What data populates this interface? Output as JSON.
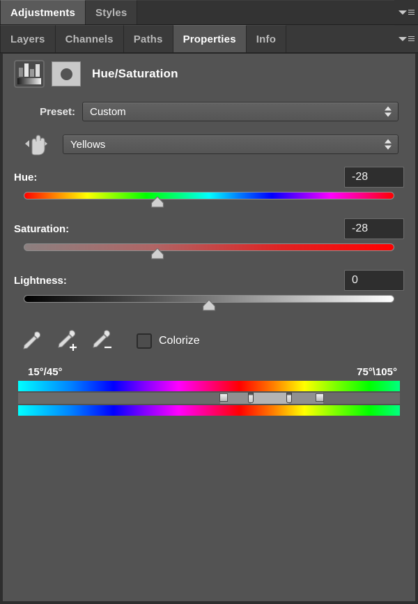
{
  "window": {
    "top_tabs": [
      {
        "label": "Adjustments",
        "active": true
      },
      {
        "label": "Styles",
        "active": false
      }
    ],
    "panel_tabs": [
      {
        "label": "Layers",
        "active": false
      },
      {
        "label": "Channels",
        "active": false
      },
      {
        "label": "Paths",
        "active": false
      },
      {
        "label": "Properties",
        "active": true
      },
      {
        "label": "Info",
        "active": false
      }
    ],
    "menu_icon": "panel-menu-icon"
  },
  "adjustment": {
    "title": "Hue/Saturation",
    "adjust_icon": "hue-saturation-adjustment-icon",
    "mask_icon": "layer-mask-thumbnail-icon"
  },
  "preset": {
    "label": "Preset:",
    "value": "Custom"
  },
  "channel": {
    "value": "Yellows",
    "tool_icon": "on-image-adjustment-hand-icon"
  },
  "sliders": [
    {
      "name": "hue",
      "label": "Hue:",
      "value": "-28",
      "thumb_percent": 36
    },
    {
      "name": "saturation",
      "label": "Saturation:",
      "value": "-28",
      "thumb_percent": 36
    },
    {
      "name": "lightness",
      "label": "Lightness:",
      "value": "0",
      "thumb_percent": 50
    }
  ],
  "tools": {
    "eyedropper": "eyedropper-icon",
    "eyedropper_add": "eyedropper-add-icon",
    "eyedropper_subtract": "eyedropper-subtract-icon",
    "colorize_label": "Colorize",
    "colorize_checked": false
  },
  "range": {
    "left_label": "15°/45°",
    "right_label": "75°\\105°",
    "outer_left_percent": 53,
    "inner_left_percent": 61,
    "inner_right_percent": 71,
    "outer_right_percent": 80
  },
  "colors": {
    "panel_bg": "#535353",
    "tab_active_bg": "#5a5a5a",
    "value_field_bg": "#2e2e2e",
    "text": "#ffffff"
  }
}
